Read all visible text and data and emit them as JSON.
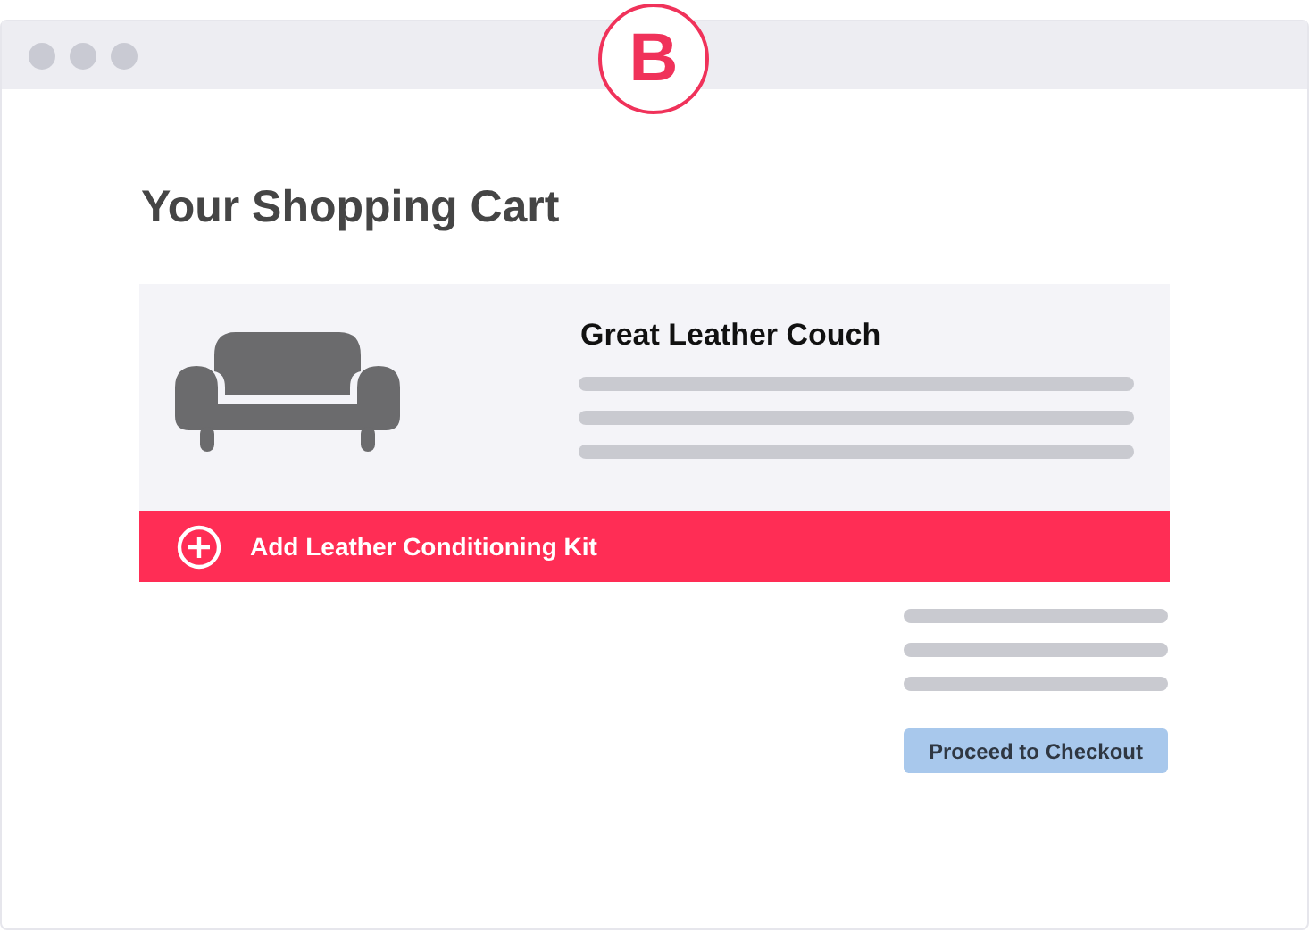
{
  "badge": {
    "letter": "B"
  },
  "heading": "Your Shopping Cart",
  "cart_item": {
    "name": "Great Leather Couch"
  },
  "add_on": {
    "label": "Add Leather Conditioning Kit"
  },
  "checkout_button": {
    "label": "Proceed to Checkout"
  }
}
